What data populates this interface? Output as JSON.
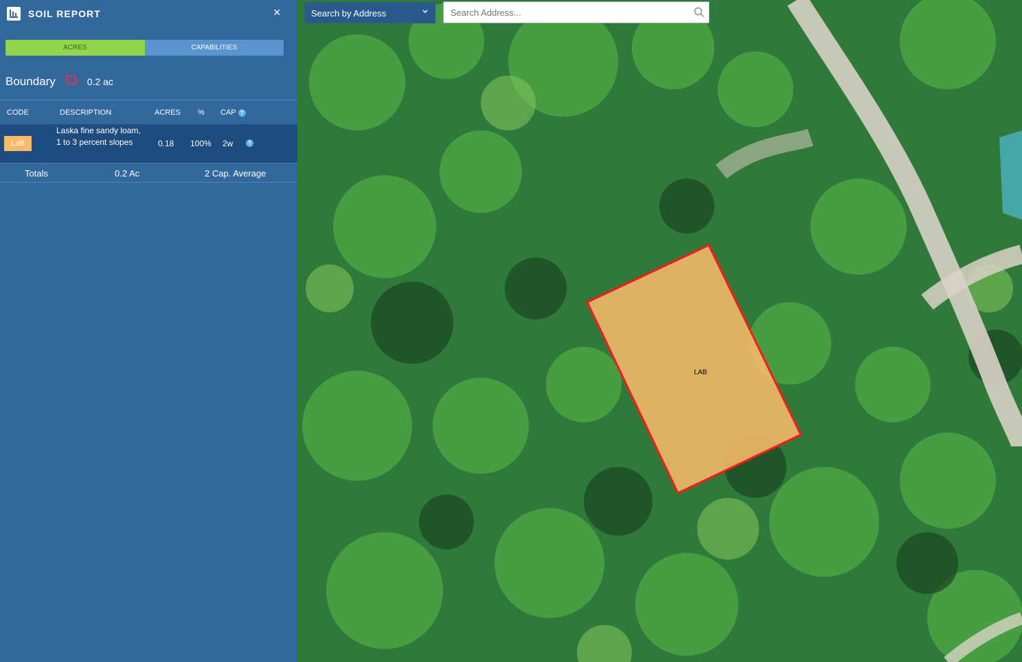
{
  "header": {
    "title": "SOIL REPORT",
    "close_label": "×"
  },
  "tabs": [
    {
      "label": "ACRES",
      "active": true
    },
    {
      "label": "CAPABILITIES",
      "active": false
    }
  ],
  "boundary": {
    "label": "Boundary",
    "value": "0.2 ac"
  },
  "table": {
    "columns": [
      "CODE",
      "DESCRIPTION",
      "ACRES",
      "%",
      "CAP"
    ],
    "rows": [
      {
        "code": "LaB",
        "description": "Laska fine sandy loam, 1 to 3 percent slopes",
        "acres": "0.18",
        "percent": "100%",
        "cap": "2w"
      }
    ]
  },
  "totals": {
    "label": "Totals",
    "acres": "0.2 Ac",
    "cap_avg": "2 Cap. Average"
  },
  "search": {
    "type_label": "Search by Address",
    "placeholder": "Search Address..."
  },
  "map": {
    "polygon_label": "LAB"
  },
  "icons": {
    "report": "bar-chart-icon",
    "close": "close-icon",
    "boundary": "polygon-icon",
    "help": "help-icon",
    "dropdown": "chevron-down-icon",
    "search": "search-icon"
  },
  "colors": {
    "sidebar_bg": "#32689c",
    "tab_active": "#8fd64b",
    "tab_inactive": "#5b93cf",
    "row_selected": "#1f4c7f",
    "soil_fill": "#f7b96a",
    "boundary_stroke": "#ff1a1a"
  }
}
